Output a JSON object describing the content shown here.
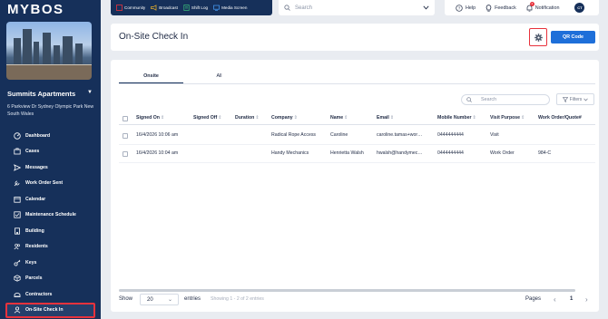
{
  "app": {
    "logo": "MYBOS"
  },
  "property": {
    "name": "Summits Apartments",
    "address": "6 Parkview Dr Sydney Olympic Park New South Wales"
  },
  "sidebar": {
    "items": [
      {
        "label": "Dashboard",
        "icon": "dashboard-icon"
      },
      {
        "label": "Cases",
        "icon": "cases-icon"
      },
      {
        "label": "Messages",
        "icon": "messages-icon"
      },
      {
        "label": "Work Order Sent",
        "icon": "work-order-icon"
      },
      {
        "label": "Calendar",
        "icon": "calendar-icon"
      },
      {
        "label": "Maintenance Schedule",
        "icon": "maintenance-icon"
      },
      {
        "label": "Building",
        "icon": "building-icon"
      },
      {
        "label": "Residents",
        "icon": "residents-icon"
      },
      {
        "label": "Keys",
        "icon": "keys-icon"
      },
      {
        "label": "Parcels",
        "icon": "parcels-icon"
      },
      {
        "label": "Contractors",
        "icon": "contractors-icon"
      },
      {
        "label": "On-Site Check In",
        "icon": "check-in-icon",
        "active": true
      }
    ]
  },
  "topnav": {
    "items": [
      "Community",
      "Broadcast",
      "Shift Log",
      "Media Screen"
    ]
  },
  "search": {
    "placeholder": "Search"
  },
  "topright": {
    "help": "Help",
    "feedback": "Feedback",
    "notification": "Notification",
    "notification_count": "4",
    "avatar": "CT"
  },
  "header": {
    "title": "On-Site Check In",
    "qr_label": "QR Code"
  },
  "tabs": [
    "Onsite",
    "All"
  ],
  "table_search": {
    "placeholder": "Search"
  },
  "filters_label": "Filters",
  "table": {
    "columns": [
      "Signed On",
      "Signed Off",
      "Duration",
      "Company",
      "Name",
      "Email",
      "Mobile Number",
      "Visit Purpose",
      "Work Order/Quote#"
    ],
    "rows": [
      [
        "16/4/2026 10:06 am",
        "",
        "",
        "Radical Rope Access",
        "Caroline",
        "caroline.tamas+wor…",
        "0444444444",
        "Visit",
        ""
      ],
      [
        "16/4/2026 10:04 am",
        "",
        "",
        "Handy Mechanics",
        "Henrietta Walsh",
        "hwalsh@handymec…",
        "0444444444",
        "Work Order",
        "984-C"
      ]
    ]
  },
  "footer": {
    "show": "Show",
    "page_size": "20",
    "entries": "entries",
    "info": "Showing 1 - 2 of 2 entries",
    "pages": "Pages",
    "current_page": "1"
  },
  "colors": {
    "sidebar_bg": "#16305a",
    "accent": "#1e6fd9",
    "highlight": "#e8323c"
  }
}
